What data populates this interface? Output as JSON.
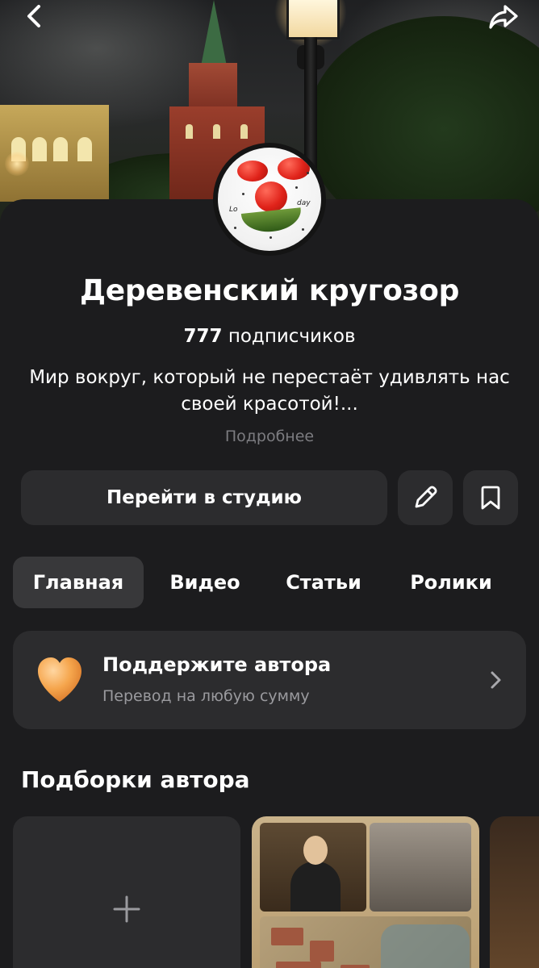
{
  "header": {
    "back_icon": "back-chevron-icon",
    "share_icon": "share-icon"
  },
  "channel": {
    "title": "Деревенский кругозор",
    "subscribers_count": "777",
    "subscribers_label": "подписчиков",
    "description": "Мир вокруг,  который не перестаёт удивлять нас своей красотой!...",
    "more_label": "Подробнее",
    "avatar_texts": [
      "Lo",
      "day"
    ]
  },
  "actions": {
    "studio_label": "Перейти в студию",
    "edit_icon": "pencil-icon",
    "bookmark_icon": "bookmark-icon"
  },
  "tabs": [
    {
      "label": "Главная",
      "active": true
    },
    {
      "label": "Видео",
      "active": false
    },
    {
      "label": "Статьи",
      "active": false
    },
    {
      "label": "Ролики",
      "active": false
    }
  ],
  "support": {
    "title": "Поддержите автора",
    "subtitle": "Перевод на любую сумму",
    "icon": "heart-icon",
    "heart_color": "#f5a54c"
  },
  "collections": {
    "title": "Подборки автора",
    "add_icon": "plus-icon"
  },
  "colors": {
    "background": "#1c1c1e",
    "card": "#2c2c2e",
    "active_tab": "#38383a",
    "muted_text": "#7c7c80",
    "secondary_text": "#9a9a9e"
  }
}
